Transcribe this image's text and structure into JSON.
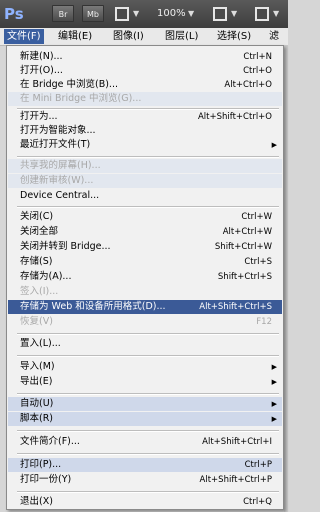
{
  "appbar": {
    "logo": "Ps",
    "btn_br": "Br",
    "btn_mb": "Mb",
    "zoom": "100%",
    "icons": [
      "bridge-icon",
      "mini-bridge-icon",
      "view-extras-icon",
      "zoom-dropdown",
      "arrange-docs-icon",
      "screen-mode-icon"
    ]
  },
  "menubar": {
    "items": [
      "文件(F)",
      "编辑(E)",
      "图像(I)",
      "图层(L)",
      "选择(S)",
      "滤镜"
    ]
  },
  "menu": {
    "new": {
      "label": "新建(N)...",
      "shortcut": "Ctrl+N"
    },
    "open": {
      "label": "打开(O)...",
      "shortcut": "Ctrl+O"
    },
    "browse_bridge": {
      "label": "在 Bridge 中浏览(B)...",
      "shortcut": "Alt+Ctrl+O"
    },
    "browse_minibridge": {
      "label": "在 Mini Bridge 中浏览(G)..."
    },
    "open_as": {
      "label": "打开为...",
      "shortcut": "Alt+Shift+Ctrl+O"
    },
    "open_smart": {
      "label": "打开为智能对象..."
    },
    "recent": {
      "label": "最近打开文件(T)"
    },
    "share_screen": {
      "label": "共享我的屏幕(H)..."
    },
    "new_review": {
      "label": "创建新审核(W)..."
    },
    "device_central": {
      "label": "Device Central..."
    },
    "close": {
      "label": "关闭(C)",
      "shortcut": "Ctrl+W"
    },
    "close_all": {
      "label": "关闭全部",
      "shortcut": "Alt+Ctrl+W"
    },
    "close_go_bridge": {
      "label": "关闭并转到 Bridge...",
      "shortcut": "Shift+Ctrl+W"
    },
    "save": {
      "label": "存储(S)",
      "shortcut": "Ctrl+S"
    },
    "save_as": {
      "label": "存储为(A)...",
      "shortcut": "Shift+Ctrl+S"
    },
    "checkin": {
      "label": "签入(I)..."
    },
    "save_web": {
      "label": "存储为 Web 和设备所用格式(D)...",
      "shortcut": "Alt+Shift+Ctrl+S"
    },
    "revert": {
      "label": "恢复(V)",
      "shortcut": "F12"
    },
    "place": {
      "label": "置入(L)..."
    },
    "import": {
      "label": "导入(M)"
    },
    "export": {
      "label": "导出(E)"
    },
    "automate": {
      "label": "自动(U)"
    },
    "scripts": {
      "label": "脚本(R)"
    },
    "file_info": {
      "label": "文件简介(F)...",
      "shortcut": "Alt+Shift+Ctrl+I"
    },
    "print": {
      "label": "打印(P)...",
      "shortcut": "Ctrl+P"
    },
    "print_one": {
      "label": "打印一份(Y)",
      "shortcut": "Alt+Shift+Ctrl+P"
    },
    "exit": {
      "label": "退出(X)",
      "shortcut": "Ctrl+Q"
    }
  },
  "colors": {
    "highlight": "#3b5a97",
    "soft_highlight": "#cfd8ea",
    "disabled_text": "#a8a8a8"
  }
}
